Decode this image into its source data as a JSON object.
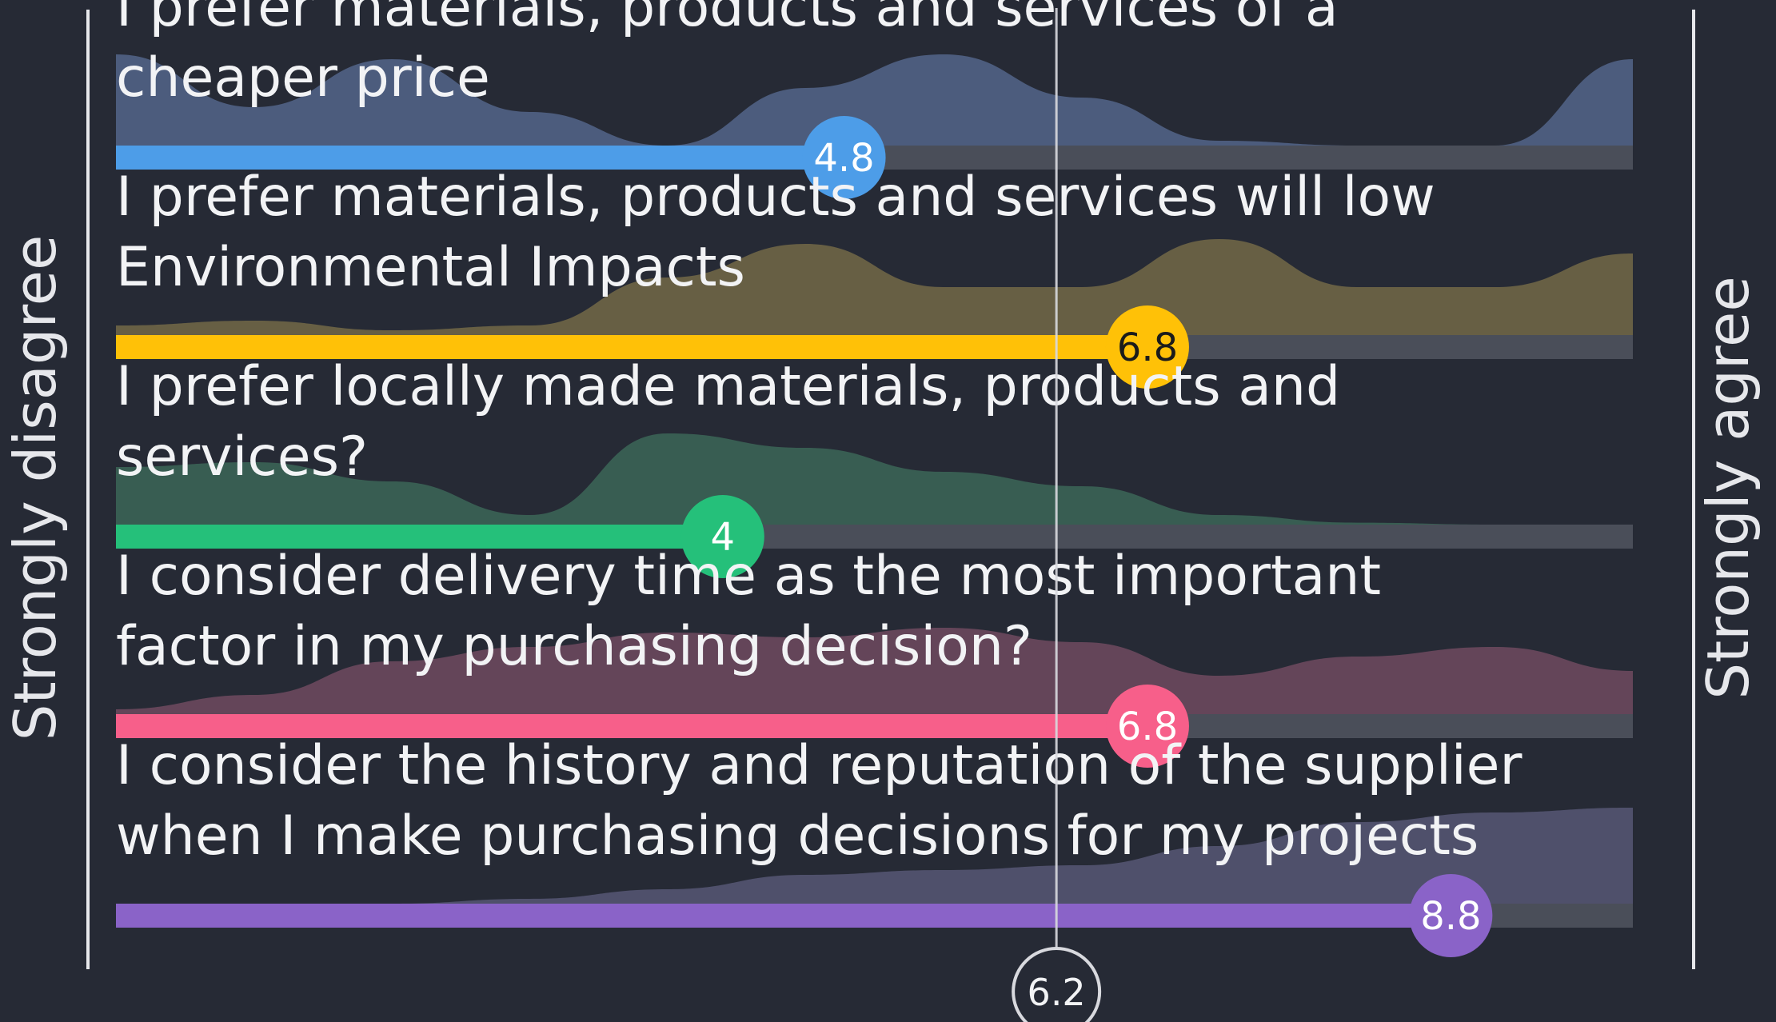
{
  "chart_data": {
    "type": "bar",
    "scale_min": 0,
    "scale_max": 10,
    "scale_labels": {
      "left": "Strongly disagree",
      "right": "Strongly agree"
    },
    "overall_average": "6.2",
    "items": [
      {
        "question_lines": [
          "I prefer materials, products and services of a",
          "cheaper price"
        ],
        "value": 4.8,
        "value_label": "4.8",
        "color": "#4d9de8",
        "label_text_color": "#ffffff",
        "distribution_color": "#5a6e96",
        "distribution": [
          0.95,
          0.4,
          0.9,
          0.35,
          0.0,
          0.6,
          0.95,
          0.5,
          0.05,
          0.0,
          0.0,
          0.9
        ]
      },
      {
        "question_lines": [
          "I prefer materials, products and services will low",
          "Environmental Impacts"
        ],
        "value": 6.8,
        "value_label": "6.8",
        "color": "#ffc107",
        "label_text_color": "#1b1b1b",
        "distribution_color": "#7d7249",
        "distribution": [
          0.1,
          0.15,
          0.05,
          0.1,
          0.6,
          0.95,
          0.5,
          0.5,
          1.0,
          0.5,
          0.5,
          0.85
        ]
      },
      {
        "question_lines": [
          "I prefer locally made materials, products and",
          "services?"
        ],
        "value": 4.0,
        "value_label": "4",
        "color": "#25c07a",
        "label_text_color": "#ffffff",
        "distribution_color": "#3f6f5c",
        "distribution": [
          0.6,
          0.65,
          0.45,
          0.1,
          0.95,
          0.8,
          0.55,
          0.4,
          0.1,
          0.02,
          0.0,
          0.0
        ]
      },
      {
        "question_lines": [
          "I consider delivery time as the most important",
          "factor in my purchasing decision?"
        ],
        "value": 6.8,
        "value_label": "6.8",
        "color": "#f75f8a",
        "label_text_color": "#ffffff",
        "distribution_color": "#7a4f66",
        "distribution": [
          0.05,
          0.2,
          0.55,
          0.7,
          0.85,
          0.8,
          0.9,
          0.75,
          0.4,
          0.6,
          0.7,
          0.45
        ]
      },
      {
        "question_lines": [
          "I consider the history and reputation of the supplier",
          "when I make purchasing decisions for my projects"
        ],
        "value": 8.8,
        "value_label": "8.8",
        "color": "#8a63c8",
        "label_text_color": "#ffffff",
        "distribution_color": "#5e5d7e",
        "distribution": [
          0.0,
          0.0,
          0.0,
          0.05,
          0.15,
          0.3,
          0.35,
          0.4,
          0.6,
          0.85,
          0.95,
          1.0
        ]
      }
    ]
  }
}
